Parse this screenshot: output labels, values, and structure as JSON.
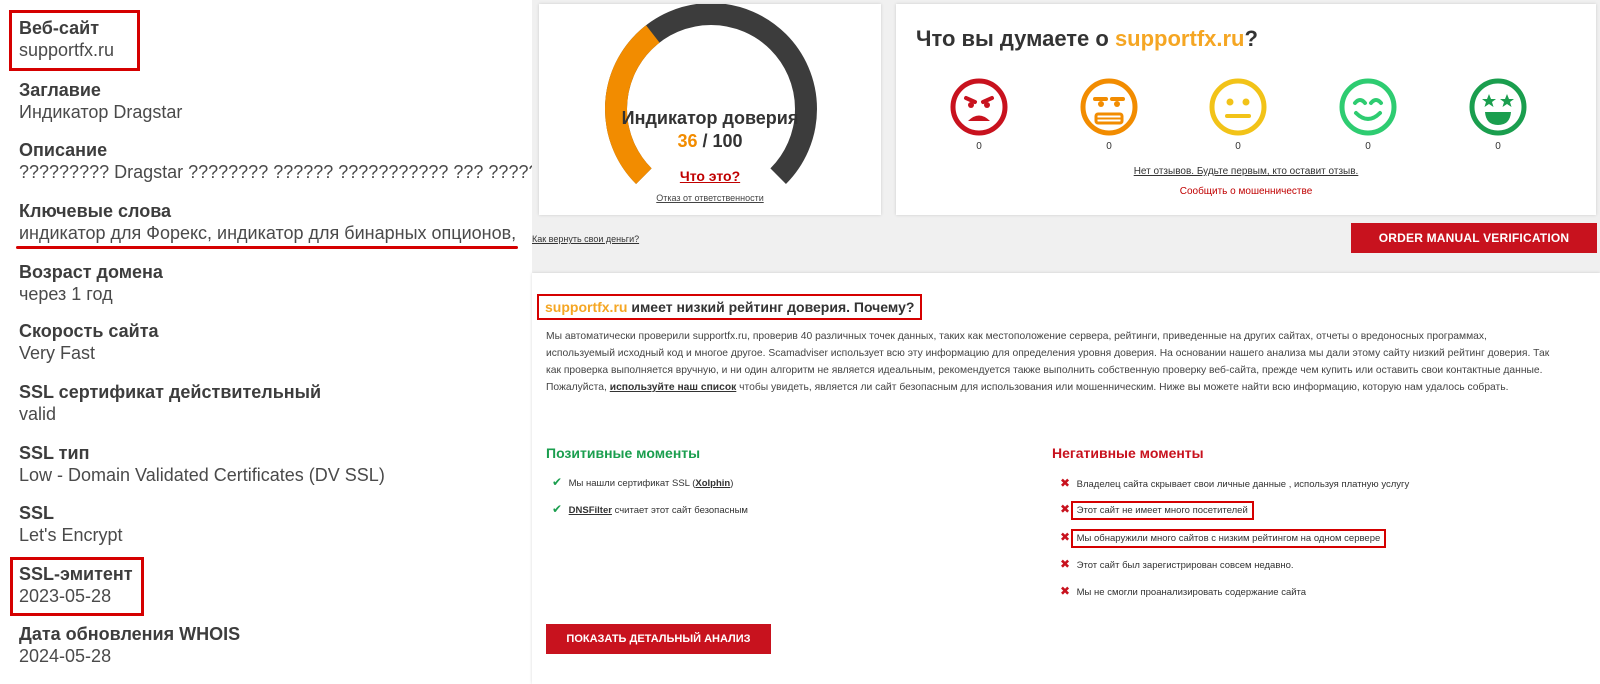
{
  "left_panel": {
    "items": [
      {
        "label": "Веб-сайт",
        "value": "supportfx.ru"
      },
      {
        "label": "Заглавие",
        "value": "Индикатор Dragstar"
      },
      {
        "label": "Описание",
        "value": "????????? Dragstar ???????? ?????? ??????????? ??? ???????? ?? ???"
      },
      {
        "label": "Ключевые слова",
        "value": "индикатор для Форекс, индикатор для бинарных опционов,"
      },
      {
        "label": "Возраст домена",
        "value": "через 1 год"
      },
      {
        "label": "Скорость сайта",
        "value": "Very Fast"
      },
      {
        "label": "SSL сертификат действительный",
        "value": "valid"
      },
      {
        "label": "SSL тип",
        "value": "Low - Domain Validated Certificates (DV SSL)"
      },
      {
        "label": "SSL",
        "value": "Let's Encrypt"
      },
      {
        "label": "SSL-эмитент",
        "value": "2023-05-28"
      },
      {
        "label": "Дата обновления WHOIS",
        "value": "2024-05-28"
      }
    ]
  },
  "trust": {
    "title": "Индикатор доверия",
    "score": "36",
    "max": "/ 100",
    "score_fraction": 0.36,
    "what_link": "Что это?",
    "disclaimer": "Отказ от ответственности",
    "colors": {
      "fill": "#f28c00",
      "track": "#3c3c3c"
    }
  },
  "opinion": {
    "title_prefix": "Что вы думаете о ",
    "site": "supportfx.ru",
    "title_suffix": "?",
    "smileys": [
      {
        "icon": "angry-face-icon",
        "color": "#c8121e",
        "count": "0"
      },
      {
        "icon": "annoyed-face-icon",
        "color": "#f28c00",
        "count": "0"
      },
      {
        "icon": "neutral-face-icon",
        "color": "#f2c318",
        "count": "0"
      },
      {
        "icon": "smiling-face-icon",
        "color": "#2ecc71",
        "count": "0"
      },
      {
        "icon": "star-eyes-face-icon",
        "color": "#1a9e4e",
        "count": "0"
      }
    ],
    "no_reviews": "Нет отзывов. Будьте первым, кто оставит отзыв.",
    "report": "Сообщить о мошенничестве"
  },
  "recover_link": "Как вернуть свои деньги?",
  "order_button": "ORDER MANUAL VERIFICATION",
  "analysis": {
    "site": "supportfx.ru",
    "title_rest": " имеет низкий рейтинг доверия. Почему?",
    "body_1": "Мы автоматически проверили supportfx.ru, проверив 40 различных точек данных, таких как местоположение сервера, рейтинги, приведенные на других сайтах, отчеты о вредоносных программах, используемый исходный код и многое другое. Scamadviser использует всю эту информацию для определения уровня доверия. На основании нашего анализа мы дали этому сайту низкий рейтинг доверия. Так как проверка выполняется вручную, и ни один алгоритм не является идеальным, рекомендуется также выполнить собственную проверку веб-сайта, прежде чем купить или оставить свои контактные данные. Пожалуйста, ",
    "body_link": "используйте наш список",
    "body_2": " чтобы увидеть, является ли сайт безопасным для использования или мошенническим. Ниже вы можете найти всю информацию, которую нам удалось собрать.",
    "positive_title": "Позитивные моменты",
    "negative_title": "Негативные моменты",
    "positives": [
      {
        "pre": "Мы нашли сертификат SSL (",
        "link": "Xolphin",
        "post": ")"
      },
      {
        "pre": "",
        "link": "DNSFilter",
        "post": " считает этот сайт безопасным"
      }
    ],
    "negatives": [
      "Владелец сайта скрывает свои личные данные , используя платную услугу",
      "Этот сайт не имеет много посетителей",
      "Мы обнаружили много сайтов с низким рейтингом на одном сервере",
      "Этот сайт был зарегистрирован совсем недавно.",
      "Мы не смогли проанализировать содержание сайта"
    ],
    "detail_button": "ПОКАЗАТЬ ДЕТАЛЬНЫЙ АНАЛИЗ"
  },
  "marks": {
    "check": "✔",
    "cross": "✖"
  }
}
